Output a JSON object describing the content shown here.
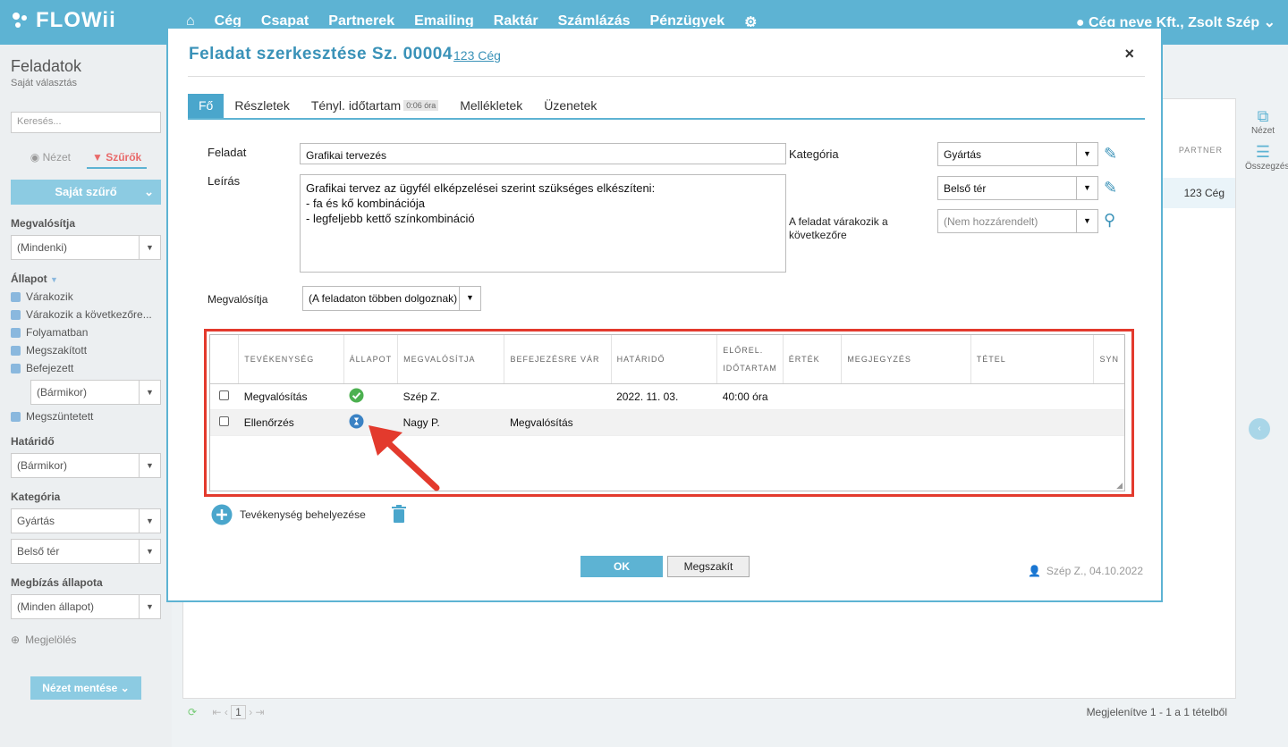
{
  "app": {
    "logo": "FLOWii",
    "nav": [
      "Cég",
      "Csapat",
      "Partnerek",
      "Emailing",
      "Raktár",
      "Számlázás",
      "Pénzügyek"
    ],
    "user": "Cég neve Kft., Zsolt Szép"
  },
  "sidebar": {
    "title": "Feladatok",
    "subtitle": "Saját választás",
    "search_placeholder": "Keresés...",
    "tab_view": "Nézet",
    "tab_filters": "Szűrők",
    "own_filter": "Saját szűrő",
    "realizer_label": "Megvalósítja",
    "realizer_value": "(Mindenki)",
    "status_label": "Állapot",
    "statuses": [
      "Várakozik",
      "Várakozik a következőre...",
      "Folyamatban",
      "Megszakított",
      "Befejezett"
    ],
    "finished_when": "(Bármikor)",
    "terminated": "Megszüntetett",
    "deadline_label": "Határidő",
    "deadline_value": "(Bármikor)",
    "category_label": "Kategória",
    "category1": "Gyártás",
    "category2": "Belső tér",
    "order_label": "Megbízás állapota",
    "order_value": "(Minden állapot)",
    "marking": "Megjelölés",
    "save_view": "Nézet mentése"
  },
  "main": {
    "partner_header": "PARTNER",
    "partner_value": "123 Cég",
    "pager_page": "1",
    "pager_info": "Megjelenítve 1 - 1 a 1 tételből"
  },
  "rail": {
    "view": "Nézet",
    "summary": "Összegzés"
  },
  "modal": {
    "title": "Feladat szerkesztése Sz. 00004",
    "company_link": "123 Cég",
    "tabs": [
      "Fő",
      "Részletek",
      "Tényl. időtartam",
      "Mellékletek",
      "Üzenetek"
    ],
    "duration_badge": "0:06 óra",
    "task_label": "Feladat",
    "task_value": "Grafikai tervezés",
    "desc_label": "Leírás",
    "desc_value": "Grafikai tervez az ügyfél elképzelései szerint szükséges elkészíteni:\n- fa és kő kombinációja\n- legfeljebb kettő színkombináció",
    "category_label": "Kategória",
    "category_value": "Gyártás",
    "category2_value": "Belső tér",
    "waits_label": "A feladat várakozik a következőre",
    "waits_value": "(Nem hozzárendelt)",
    "realizer_label": "Megvalósítja",
    "realizer_value": "(A feladaton többen dolgoznak)",
    "grid_headers": [
      "TEVÉKENYSÉG",
      "ÁLLAPOT",
      "MEGVALÓSÍTJA",
      "BEFEJEZÉSRE VÁR",
      "HATÁRIDŐ",
      "ELŐREL. IDŐTARTAM",
      "ÉRTÉK",
      "MEGJEGYZÉS",
      "TÉTEL",
      "SYN"
    ],
    "rows": [
      {
        "activity": "Megvalósítás",
        "status": "done",
        "realizer": "Szép Z.",
        "waits": "",
        "deadline": "2022. 11. 03.",
        "duration": "40:00 óra"
      },
      {
        "activity": "Ellenőrzés",
        "status": "waiting",
        "realizer": "Nagy P.",
        "waits": "Megvalósítás",
        "deadline": "",
        "duration": ""
      }
    ],
    "add_activity": "Tevékenység behelyezése",
    "ok": "OK",
    "cancel": "Megszakít",
    "author": "Szép Z., 04.10.2022"
  },
  "colors": {
    "brand": "#5db3d3",
    "highlight": "#e33a2d"
  }
}
